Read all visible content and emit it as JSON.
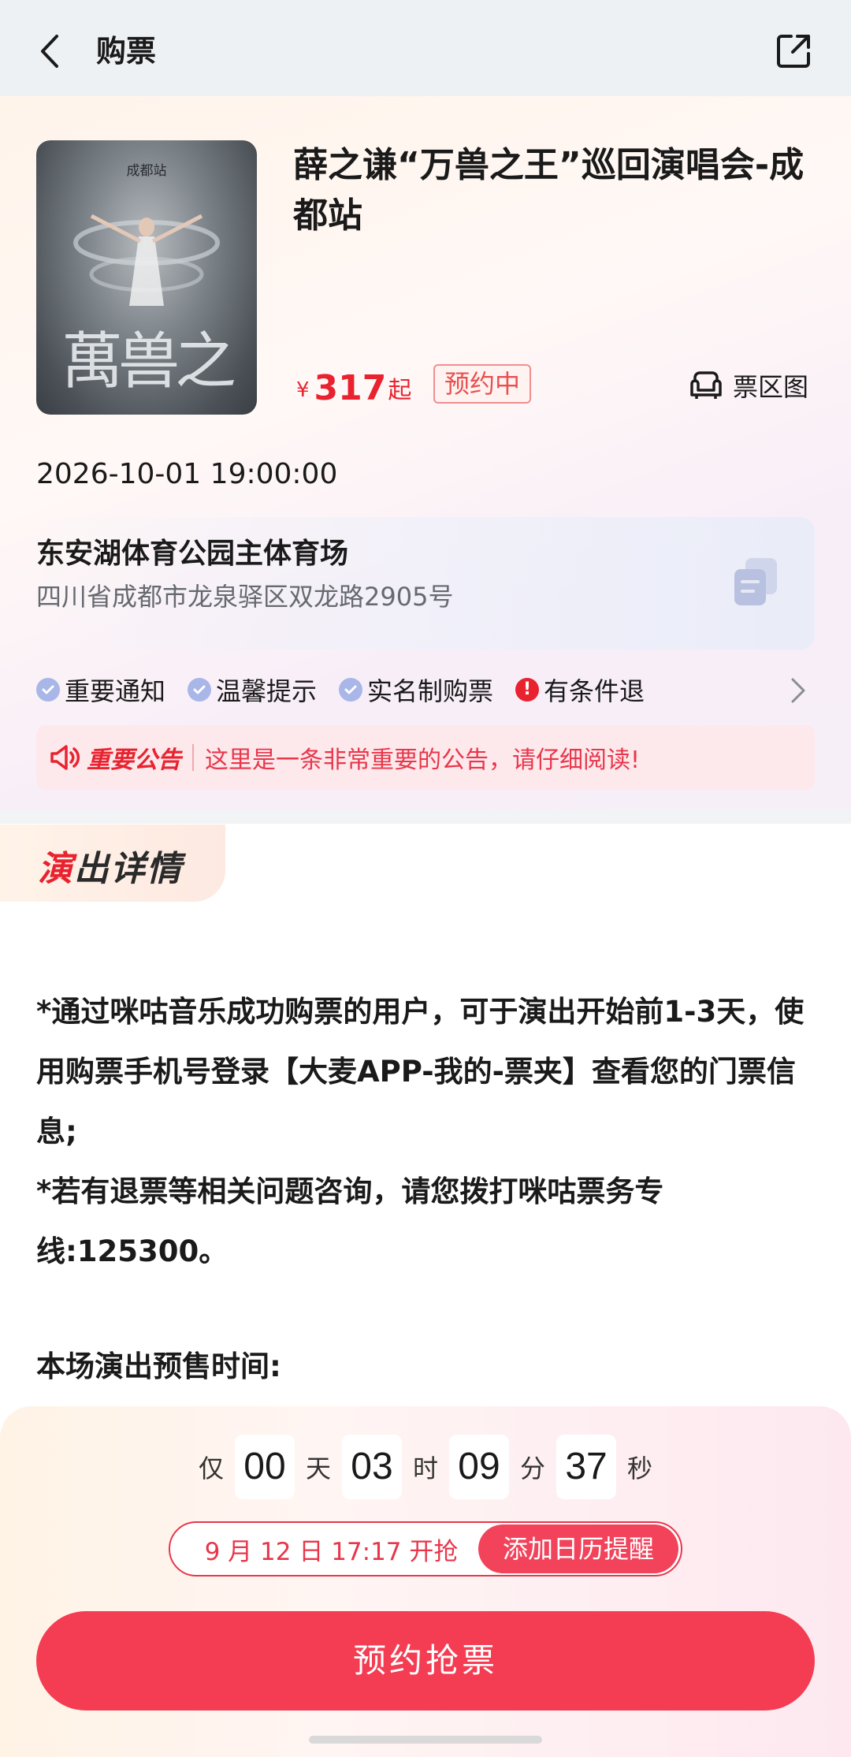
{
  "nav": {
    "title": "购票"
  },
  "event": {
    "title": "薛之谦“万兽之王”巡回演唱会-成都站",
    "poster_caption": "成都站",
    "poster_logo": "万兽之王",
    "price_currency": "¥",
    "price_value": "317",
    "price_suffix": "起",
    "status": "预约中",
    "seatmap_label": "票区图",
    "datetime": "2026-10-01 19:00:00"
  },
  "venue": {
    "name": "东安湖体育公园主体育场",
    "address": "四川省成都市龙泉驿区双龙路2905号"
  },
  "tags": [
    {
      "label": "重要通知",
      "icon": "check-icon"
    },
    {
      "label": "温馨提示",
      "icon": "check-icon"
    },
    {
      "label": "实名制购票",
      "icon": "check-icon"
    },
    {
      "label": "有条件退",
      "icon": "warning-icon"
    }
  ],
  "notice": {
    "tag": "重要公告",
    "text": "这里是一条非常重要的公告，请仔细阅读!"
  },
  "details": {
    "title_accent": "演",
    "title_rest": "出详情",
    "paragraphs": [
      "*通过咪咕音乐成功购票的用户，可于演出开始前1-3天，使用购票手机号登录【大麦APP-我的-票夹】查看您的门票信息;",
      "*若有退票等相关问题咨询，请您拨打咪咕票务专线:125300。"
    ],
    "presale_label": "本场演出预售时间:"
  },
  "countdown": {
    "prefix": "仅",
    "days": "00",
    "days_unit": "天",
    "hours": "03",
    "hours_unit": "时",
    "minutes": "09",
    "minutes_unit": "分",
    "seconds": "37",
    "seconds_unit": "秒"
  },
  "reminder": {
    "time_text": "9 月 12 日 17:17 开抢",
    "button_label": "添加日历提醒"
  },
  "actions": {
    "reserve_label": "预约抢票"
  },
  "colors": {
    "accent_red": "#e8232f",
    "button_red": "#f43c53",
    "tag_check": "#a9b6e8"
  }
}
